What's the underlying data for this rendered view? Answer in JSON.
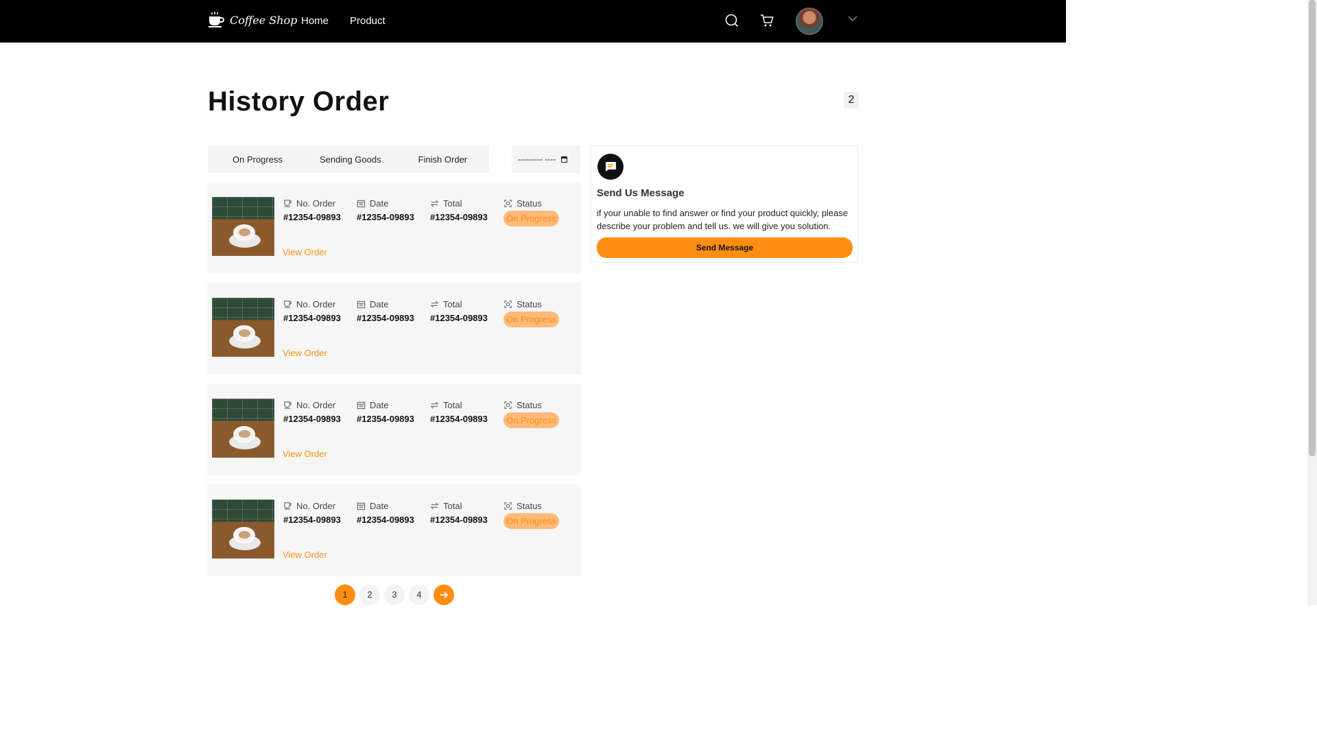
{
  "navbar": {
    "logo_text": "Coffee Shop",
    "links": [
      "Home",
      "Product"
    ],
    "icons": [
      "search-icon",
      "cart-icon",
      "chevron-down-icon"
    ]
  },
  "page": {
    "title": "History Order",
    "count": "2"
  },
  "tabs": [
    "On Progress",
    "Sending Goods",
    "Finish Order"
  ],
  "date_filter": {
    "placeholder": "--------- ----"
  },
  "order_labels": {
    "no_order": "No. Order",
    "date": "Date",
    "total": "Total",
    "status": "Status",
    "view": "View Order"
  },
  "orders": [
    {
      "no_order": "#12354-09893",
      "date": "#12354-09893",
      "total": "#12354-09893",
      "status": "On Progress"
    },
    {
      "no_order": "#12354-09893",
      "date": "#12354-09893",
      "total": "#12354-09893",
      "status": "On Progress"
    },
    {
      "no_order": "#12354-09893",
      "date": "#12354-09893",
      "total": "#12354-09893",
      "status": "On Progress"
    },
    {
      "no_order": "#12354-09893",
      "date": "#12354-09893",
      "total": "#12354-09893",
      "status": "On Progress"
    }
  ],
  "message_panel": {
    "title": "Send Us Message",
    "description": "if your unable to find answer or find your product quickly, please describe your problem and tell us. we will give you solution.",
    "button": "Send Message"
  },
  "pagination": {
    "pages": [
      "1",
      "2",
      "3",
      "4"
    ],
    "current": "1"
  },
  "colors": {
    "accent": "#ff8d12",
    "status_bg": "#ffba7a",
    "navbar": "#000000",
    "card_bg": "#f6f6f6"
  }
}
